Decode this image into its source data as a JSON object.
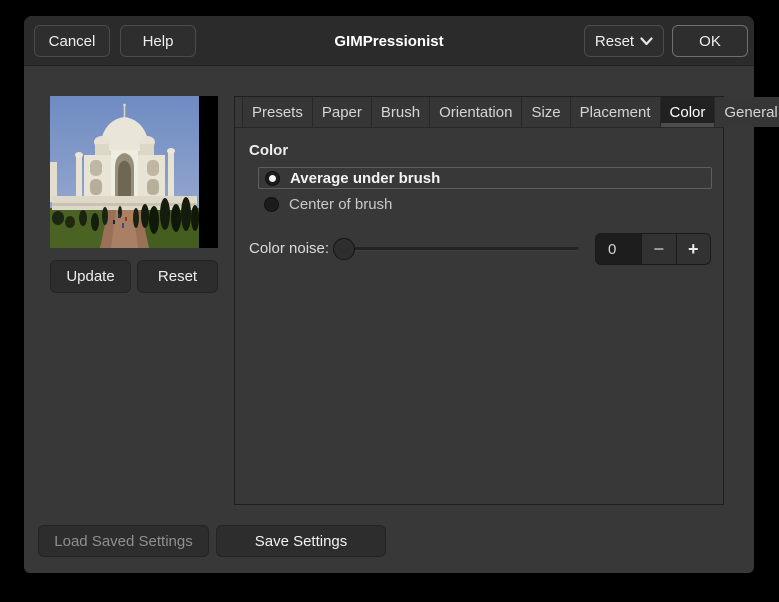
{
  "window": {
    "title": "GIMPressionist"
  },
  "titlebar": {
    "cancel_label": "Cancel",
    "help_label": "Help",
    "reset_label": "Reset",
    "ok_label": "OK"
  },
  "preview": {
    "update_label": "Update",
    "reset_label": "Reset",
    "description": "Taj Mahal photo preview thumbnail"
  },
  "tabs": [
    {
      "label": "Presets",
      "active": false
    },
    {
      "label": "Paper",
      "active": false
    },
    {
      "label": "Brush",
      "active": false
    },
    {
      "label": "Orientation",
      "active": false
    },
    {
      "label": "Size",
      "active": false
    },
    {
      "label": "Placement",
      "active": false
    },
    {
      "label": "Color",
      "active": true
    },
    {
      "label": "General",
      "active": false
    }
  ],
  "color_panel": {
    "frame_title": "Color",
    "options": [
      {
        "label": "Average under brush",
        "selected": true
      },
      {
        "label": "Center of brush",
        "selected": false
      }
    ],
    "noise_label": "Color noise:",
    "noise_value": "0",
    "minus_label": "−",
    "plus_label": "+",
    "slider_percent": 0
  },
  "footer": {
    "load_label": "Load Saved Settings",
    "load_enabled": false,
    "save_label": "Save Settings"
  },
  "colors": {
    "window_bg": "#383838",
    "titlebar_bg": "#2b2b2b",
    "active_tab_bg": "#212121",
    "entry_bg": "#1d1d1d",
    "radio_dot": "#f4f4f4",
    "sky_blue": "#6e8bc2"
  }
}
